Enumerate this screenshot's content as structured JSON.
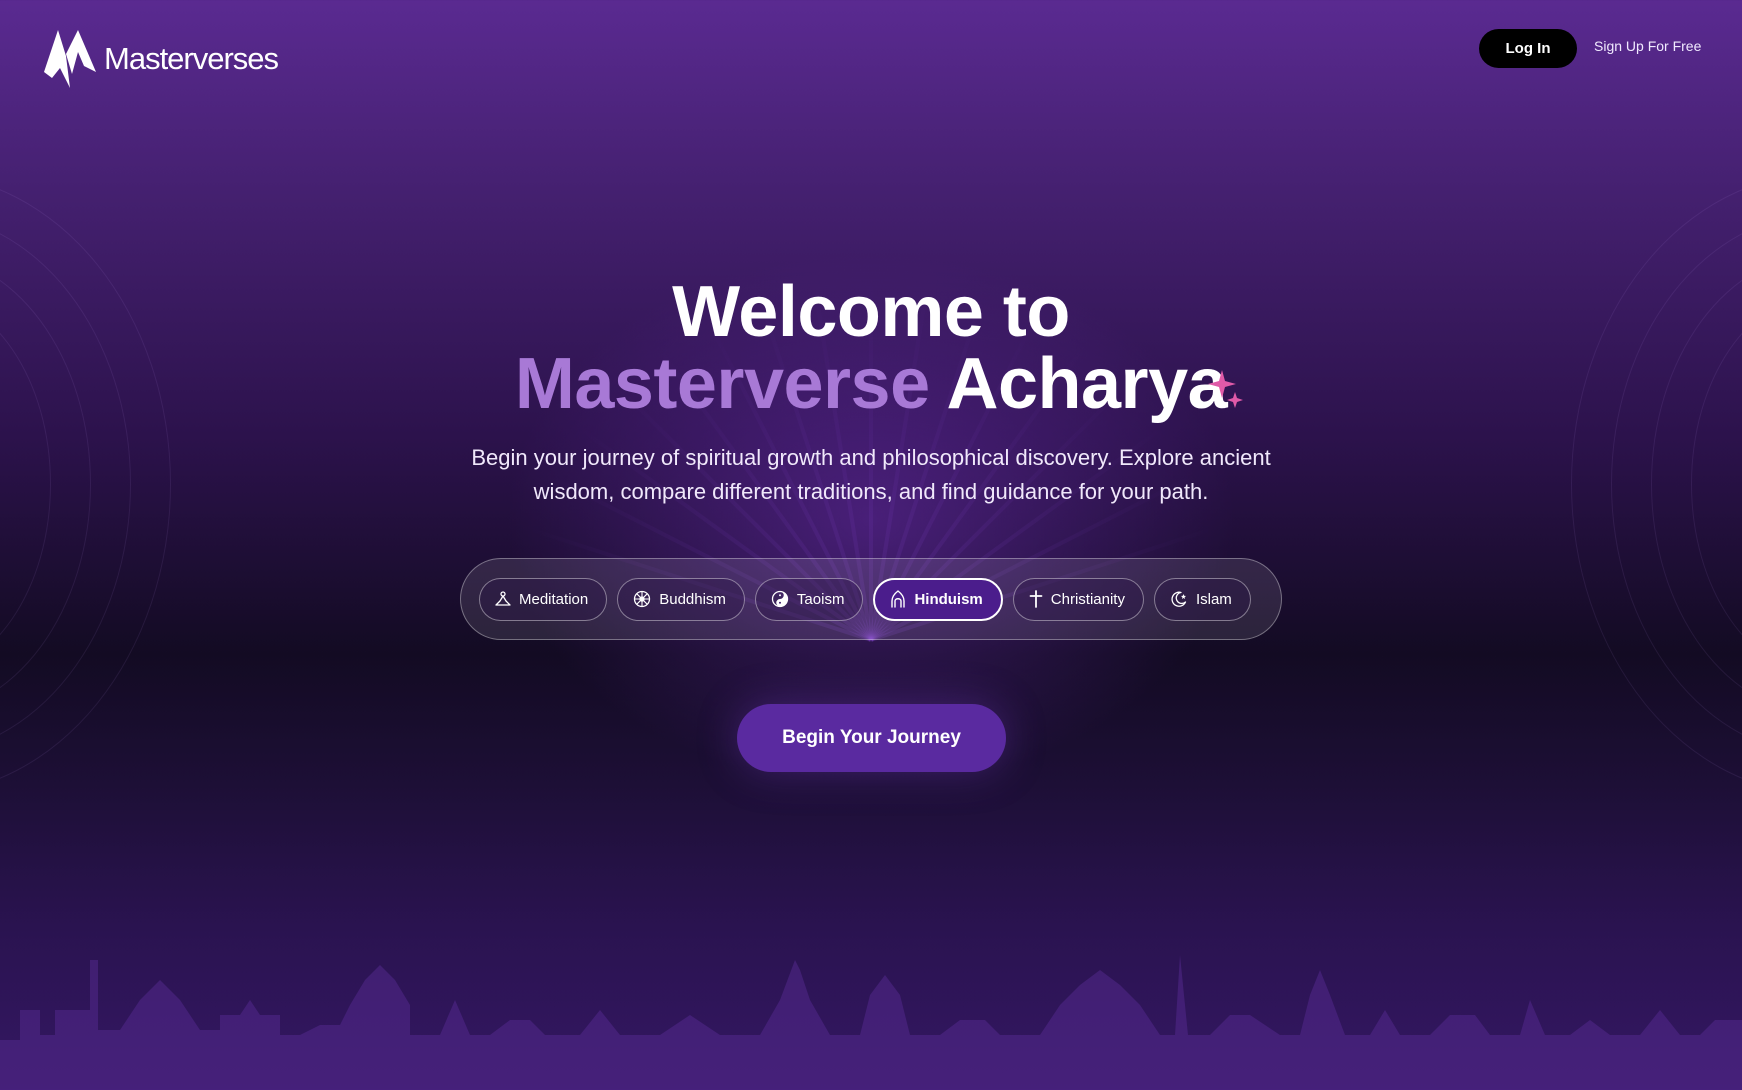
{
  "brand": {
    "name": "Masterverses"
  },
  "header": {
    "login_label": "Log In",
    "signup_label": "Sign Up For Free"
  },
  "hero": {
    "title_line1": "Welcome to",
    "title_accent": "Masterverse",
    "title_line2_rest": "Acharya",
    "subtitle": "Begin your journey of spiritual growth and philosophical discovery. Explore ancient wisdom, compare different traditions, and find guidance for your path."
  },
  "traditions": {
    "selected": "Hinduism",
    "items": [
      {
        "label": "Meditation",
        "icon": "meditation-icon"
      },
      {
        "label": "Buddhism",
        "icon": "dharma-wheel-icon"
      },
      {
        "label": "Taoism",
        "icon": "yin-yang-icon"
      },
      {
        "label": "Hinduism",
        "icon": "om-icon"
      },
      {
        "label": "Christianity",
        "icon": "cross-icon"
      },
      {
        "label": "Islam",
        "icon": "crescent-star-icon"
      }
    ]
  },
  "cta": {
    "label": "Begin Your Journey"
  },
  "colors": {
    "accent": "#a879d6",
    "sparkle": "#e05aa8",
    "button": "#5a2aa0"
  }
}
